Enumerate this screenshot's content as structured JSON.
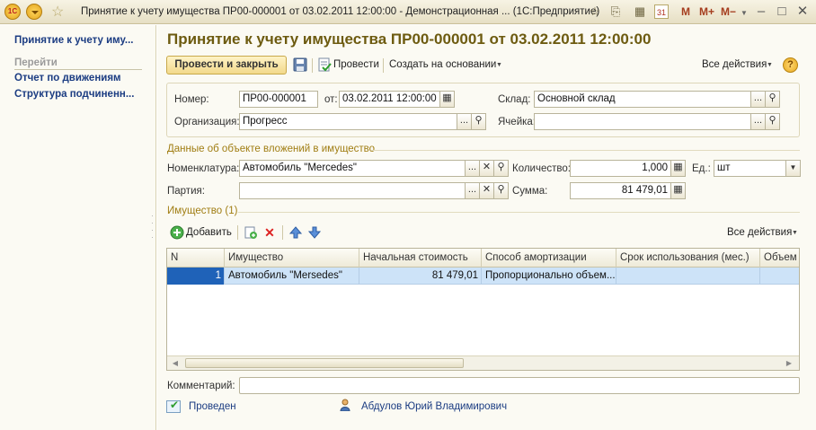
{
  "window": {
    "logo_text": "1С",
    "title": "Принятие к учету имущества ПР00-000001 от 03.02.2011 12:00:00 - Демонстрационная ... (1С:Предприятие)",
    "memory_buttons": [
      "M",
      "M+",
      "M−"
    ]
  },
  "sidebar": {
    "items": [
      {
        "label": "Принятие к учету иму..."
      }
    ],
    "goto_header": "Перейти",
    "goto_items": [
      {
        "label": "Отчет по движениям"
      },
      {
        "label": "Структура подчиненн..."
      }
    ]
  },
  "form": {
    "title": "Принятие к учету имущества ПР00-000001 от 03.02.2011 12:00:00",
    "toolbar": {
      "post_and_close": "Провести и закрыть",
      "post": "Провести",
      "create_based_on": "Создать на основании",
      "all_actions": "Все действия",
      "help": "?"
    },
    "header": {
      "number_label": "Номер:",
      "number_value": "ПР00-000001",
      "date_label": "от:",
      "date_value": "03.02.2011 12:00:00",
      "warehouse_label": "Склад:",
      "warehouse_value": "Основной склад",
      "organization_label": "Организация:",
      "organization_value": "Прогресс",
      "cell_label": "Ячейка:",
      "cell_value": ""
    },
    "investment": {
      "section_title": "Данные об объекте вложений в имущество",
      "nomenclature_label": "Номенклатура:",
      "nomenclature_value": "Автомобиль \"Mercedes\"",
      "quantity_label": "Количество:",
      "quantity_value": "1,000",
      "unit_label": "Ед.:",
      "unit_value": "шт",
      "batch_label": "Партия:",
      "batch_value": "",
      "sum_label": "Сумма:",
      "sum_value": "81 479,01"
    },
    "property": {
      "section_title": "Имущество (1)",
      "add_label": "Добавить",
      "all_actions": "Все действия",
      "columns": [
        "N",
        "Имущество",
        "Начальная стоимость",
        "Способ амортизации",
        "Срок использования (мес.)",
        "Объем"
      ],
      "rows": [
        {
          "n": "1",
          "property": "Автомобиль \"Mersedes\"",
          "initial_cost": "81 479,01",
          "depreciation_method": "Пропорционально объем...",
          "usage_term": "",
          "volume": ""
        }
      ]
    },
    "comment_label": "Комментарий:",
    "comment_value": "",
    "status": {
      "posted": "Проведен",
      "author": "Абдулов Юрий Владимирович"
    }
  },
  "colors": {
    "title_text": "#6d5b10",
    "link": "#1b3c82",
    "section": "#a07d12",
    "selected_row": "#cde3f8",
    "selected_cell": "#1f62b8"
  }
}
